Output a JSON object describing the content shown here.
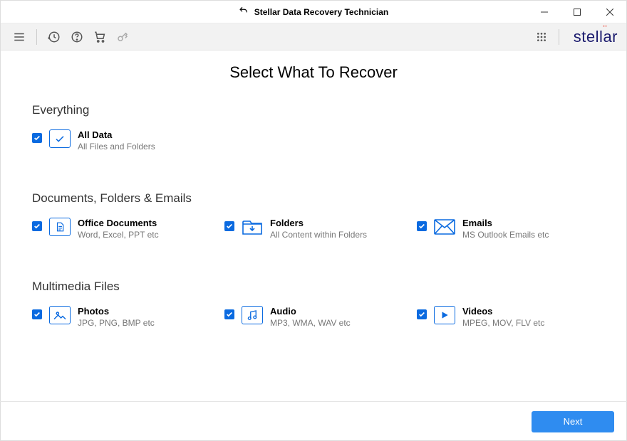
{
  "titlebar": {
    "app_title": "Stellar Data Recovery Technician"
  },
  "toolbar": {
    "brand_text": "stellar"
  },
  "main": {
    "page_title": "Select What To Recover",
    "sections": {
      "everything": {
        "title": "Everything",
        "all_data": {
          "title": "All Data",
          "desc": "All Files and Folders"
        }
      },
      "documents": {
        "title": "Documents, Folders & Emails",
        "office": {
          "title": "Office Documents",
          "desc": "Word, Excel, PPT etc"
        },
        "folders": {
          "title": "Folders",
          "desc": "All Content within Folders"
        },
        "emails": {
          "title": "Emails",
          "desc": "MS Outlook Emails etc"
        }
      },
      "multimedia": {
        "title": "Multimedia Files",
        "photos": {
          "title": "Photos",
          "desc": "JPG, PNG, BMP etc"
        },
        "audio": {
          "title": "Audio",
          "desc": "MP3, WMA, WAV etc"
        },
        "videos": {
          "title": "Videos",
          "desc": "MPEG, MOV, FLV etc"
        }
      }
    }
  },
  "footer": {
    "next_label": "Next"
  }
}
